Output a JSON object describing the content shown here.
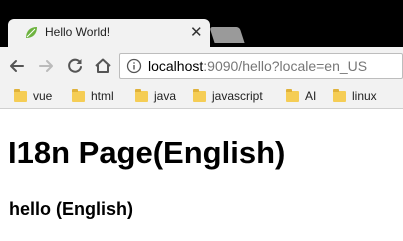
{
  "tab": {
    "title": "Hello World!",
    "close_glyph": "✕",
    "icon": "spring-leaf-icon",
    "icon_color": "#6db33f"
  },
  "toolbar": {
    "back_icon": "back-arrow-icon",
    "forward_icon": "forward-arrow-icon",
    "reload_icon": "reload-icon",
    "home_icon": "home-icon"
  },
  "address_bar": {
    "host": "localhost",
    "rest": ":9090/hello?locale=en_US",
    "icon": "page-info-icon"
  },
  "bookmarks": [
    {
      "label": "vue"
    },
    {
      "label": "html"
    },
    {
      "label": "java"
    },
    {
      "label": "javascript"
    },
    {
      "label": "AI"
    },
    {
      "label": "linux"
    }
  ],
  "page": {
    "heading": "I18n Page(English)",
    "subheading": "hello (English)"
  },
  "colors": {
    "chrome_bg": "#f2f2f2",
    "tabstrip_bg": "#000000",
    "folder": "#f5cd55"
  }
}
